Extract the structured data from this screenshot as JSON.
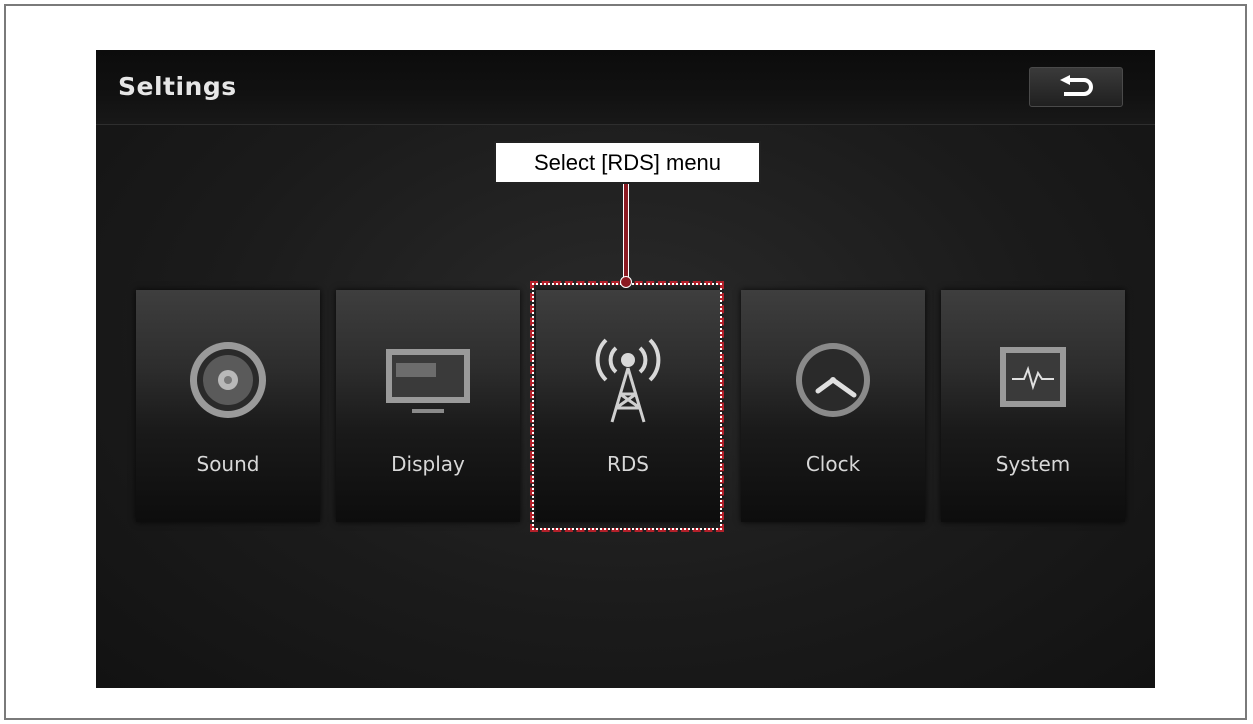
{
  "screen": {
    "title": "Seltings",
    "back_icon": "back-arrow-icon"
  },
  "menu": {
    "items": [
      {
        "label": "Sound",
        "icon": "speaker-icon"
      },
      {
        "label": "Display",
        "icon": "monitor-icon"
      },
      {
        "label": "RDS",
        "icon": "antenna-icon"
      },
      {
        "label": "Clock",
        "icon": "clock-icon"
      },
      {
        "label": "System",
        "icon": "system-monitor-icon"
      }
    ]
  },
  "annotation": {
    "callout_text": "Select [RDS] menu",
    "highlight_color": "#b3202a"
  }
}
